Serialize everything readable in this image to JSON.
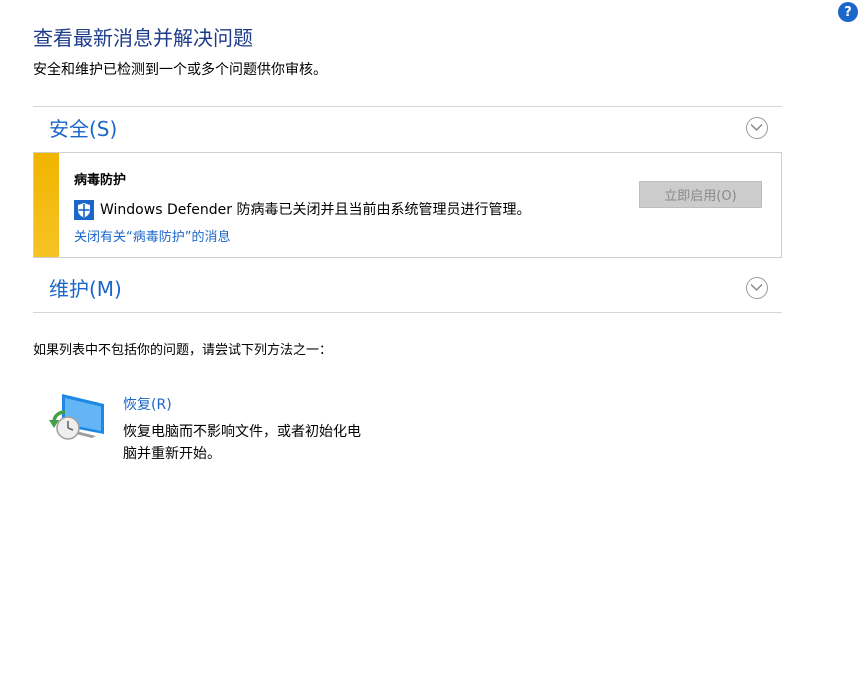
{
  "help": {
    "label": "?"
  },
  "header": {
    "title": "查看最新消息并解决问题",
    "subtitle": "安全和维护已检测到一个或多个问题供你审核。"
  },
  "sections": {
    "security": {
      "title": "安全(S)",
      "icon": "chevron-down-icon"
    },
    "maintenance": {
      "title": "维护(M)",
      "icon": "chevron-down-icon"
    }
  },
  "alert": {
    "title": "病毒防护",
    "message": "Windows Defender 防病毒已关闭并且当前由系统管理员进行管理。",
    "dismiss_link": "关闭有关“病毒防护”的消息",
    "action_button": "立即启用(O)",
    "stripe_color": "#f0b400",
    "icon": "shield-icon"
  },
  "hint": "如果列表中不包括你的问题，请尝试下列方法之一：",
  "recovery": {
    "link": "恢复(R)",
    "description": "恢复电脑而不影响文件，或者初始化电脑并重新开始。",
    "icon": "recovery-pc-icon"
  },
  "colors": {
    "accent": "#1b66c9",
    "title": "#1e3c8c",
    "divider": "#d6d6d6"
  }
}
